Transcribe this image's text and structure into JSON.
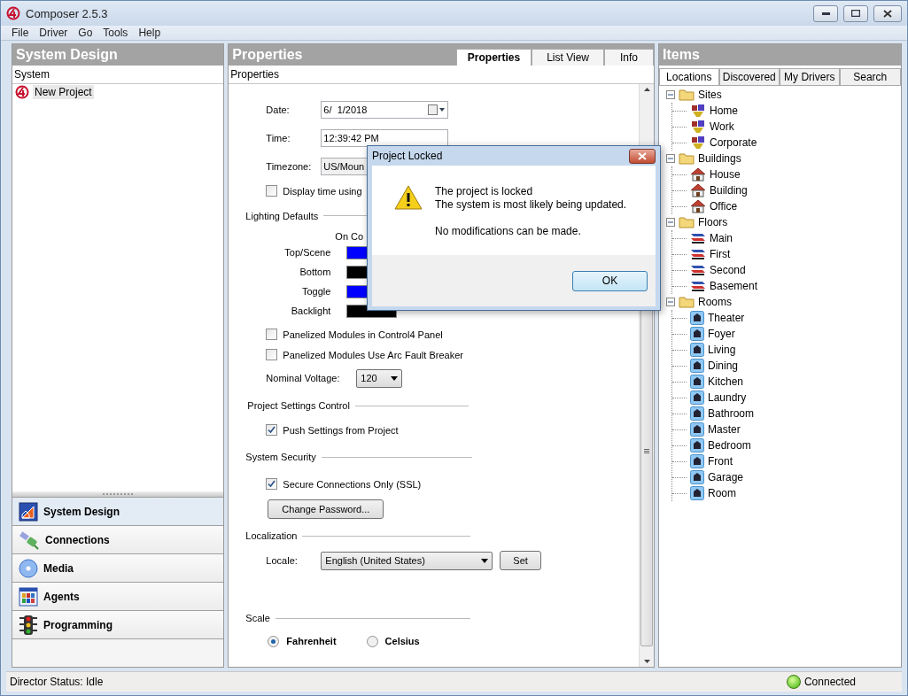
{
  "window": {
    "title": "Composer 2.5.3"
  },
  "menu": [
    "File",
    "Driver",
    "Go",
    "Tools",
    "Help"
  ],
  "system_design": {
    "title": "System Design",
    "column": "System",
    "tree": [
      {
        "label": "New Project",
        "selected": true
      }
    ],
    "nav": [
      {
        "label": "System Design",
        "selected": true
      },
      {
        "label": "Connections",
        "selected": false
      },
      {
        "label": "Media",
        "selected": false
      },
      {
        "label": "Agents",
        "selected": false
      },
      {
        "label": "Programming",
        "selected": false
      }
    ]
  },
  "properties": {
    "title": "Properties",
    "tabs": [
      {
        "label": "Properties",
        "selected": true
      },
      {
        "label": "List View",
        "selected": false
      },
      {
        "label": "Info",
        "selected": false
      }
    ],
    "subtitle": "Properties",
    "date": {
      "label": "Date:",
      "value": "6/  1/2018"
    },
    "time": {
      "label": "Time:",
      "value": "12:39:42 PM"
    },
    "timezone": {
      "label": "Timezone:",
      "value": "US/Moun"
    },
    "display_time": {
      "label": "Display time using",
      "checked": false
    },
    "lighting": {
      "title": "Lighting Defaults",
      "column": "On Co",
      "rows": [
        {
          "label": "Top/Scene",
          "color": "#0000ff"
        },
        {
          "label": "Bottom",
          "color": "#000000"
        },
        {
          "label": "Toggle",
          "color": "#0000ff"
        },
        {
          "label": "Backlight",
          "color": "#000000"
        }
      ]
    },
    "panel_checks": [
      {
        "label": "Panelized Modules in Control4 Panel",
        "checked": false
      },
      {
        "label": "Panelized Modules Use Arc Fault Breaker",
        "checked": false
      }
    ],
    "voltage": {
      "label": "Nominal Voltage:",
      "value": "120"
    },
    "project_settings": {
      "title": "Project Settings Control",
      "checks": [
        {
          "label": "Push Settings from Project",
          "checked": true
        }
      ]
    },
    "security": {
      "title": "System Security",
      "checks": [
        {
          "label": "Secure Connections Only (SSL)",
          "checked": true
        }
      ],
      "button": "Change Password..."
    },
    "localization": {
      "title": "Localization",
      "label": "Locale:",
      "value": "English (United States)",
      "button": "Set"
    },
    "scale": {
      "title": "Scale",
      "options": [
        {
          "label": "Fahrenheit",
          "selected": true
        },
        {
          "label": "Celsius",
          "selected": false
        }
      ]
    }
  },
  "items": {
    "title": "Items",
    "tabs": [
      {
        "label": "Locations",
        "selected": true
      },
      {
        "label": "Discovered",
        "selected": false
      },
      {
        "label": "My Drivers",
        "selected": false
      },
      {
        "label": "Search",
        "selected": false
      }
    ],
    "tree": [
      {
        "label": "Sites",
        "kind": "sites",
        "expanded": true,
        "children": [
          {
            "label": "Home"
          },
          {
            "label": "Work"
          },
          {
            "label": "Corporate"
          }
        ]
      },
      {
        "label": "Buildings",
        "kind": "buildings",
        "expanded": true,
        "children": [
          {
            "label": "House"
          },
          {
            "label": "Building"
          },
          {
            "label": "Office"
          }
        ]
      },
      {
        "label": "Floors",
        "kind": "floors",
        "expanded": true,
        "children": [
          {
            "label": "Main"
          },
          {
            "label": "First"
          },
          {
            "label": "Second"
          },
          {
            "label": "Basement"
          }
        ]
      },
      {
        "label": "Rooms",
        "kind": "rooms",
        "expanded": true,
        "children": [
          {
            "label": "Theater"
          },
          {
            "label": "Foyer"
          },
          {
            "label": "Living"
          },
          {
            "label": "Dining"
          },
          {
            "label": "Kitchen"
          },
          {
            "label": "Laundry"
          },
          {
            "label": "Bathroom"
          },
          {
            "label": "Master"
          },
          {
            "label": "Bedroom"
          },
          {
            "label": "Front"
          },
          {
            "label": "Garage"
          },
          {
            "label": "Room"
          }
        ]
      }
    ]
  },
  "status_bar": {
    "status": "Director Status: Idle",
    "connection": "Connected",
    "connected": true
  },
  "dialog": {
    "title": "Project Locked",
    "lines": [
      "The project is locked",
      "The system is most likely being updated."
    ],
    "note": "No modifications can be made.",
    "button": "OK"
  }
}
